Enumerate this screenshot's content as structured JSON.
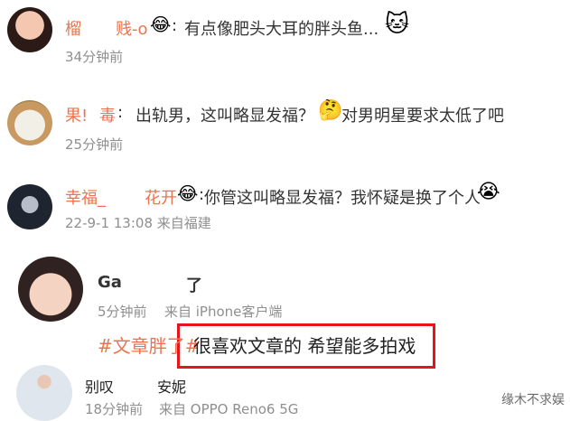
{
  "comments": [
    {
      "name_a": "榴",
      "name_b": "贱-o",
      "sep": ":",
      "text": "有点像肥头大耳的胖头鱼...",
      "time": "34分钟前"
    },
    {
      "name_a": "果!",
      "name_b": "毒",
      "sep": ":",
      "text_a": "出轨男，这叫略显发福？",
      "text_b": "对男明星要求太低了吧",
      "time": "25分钟前"
    },
    {
      "name_a": "幸福_",
      "name_b": "花开",
      "sep": ":",
      "text": "你管这叫略显发福？我怀疑是换了个人",
      "time": "22-9-1 13:08 来自福建"
    },
    {
      "name_a": "Ga",
      "name_b": "了",
      "time": "5分钟前",
      "source": "来自 iPhone客户端",
      "topic": "#文章胖了#",
      "text": "很喜欢文章的 希望能多拍戏"
    },
    {
      "name_a": "别叹",
      "name_b": "安妮",
      "time": "18分钟前",
      "source": "来自 OPPO Reno6 5G"
    }
  ],
  "watermark": "缘木不求娱",
  "colors": {
    "name": "#eb7350",
    "highlight_border": "#e8141b",
    "time": "#8f8f8f"
  }
}
